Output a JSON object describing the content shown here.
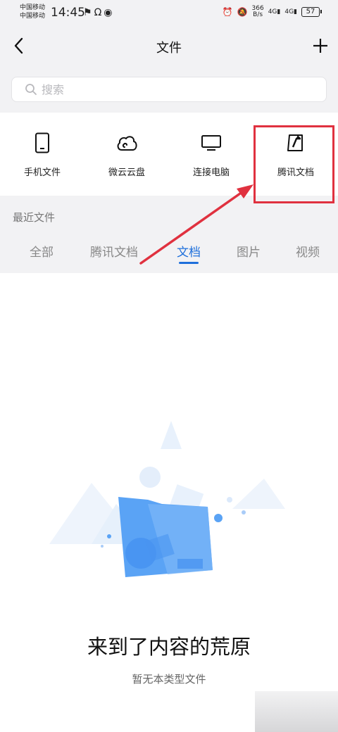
{
  "status_bar": {
    "carrier_1": "中国移动",
    "carrier_2": "中国移动",
    "time": "14:45",
    "speed_value": "366",
    "speed_unit": "B/s",
    "signal_1": "4G",
    "signal_2": "4G",
    "battery": "57"
  },
  "header": {
    "title": "文件"
  },
  "search": {
    "placeholder": "搜索"
  },
  "quick_access": [
    {
      "label": "手机文件",
      "icon": "phone-icon"
    },
    {
      "label": "微云云盘",
      "icon": "cloud-icon"
    },
    {
      "label": "连接电脑",
      "icon": "monitor-icon"
    },
    {
      "label": "腾讯文档",
      "icon": "tencent-docs-icon"
    }
  ],
  "recent": {
    "title": "最近文件",
    "tabs": [
      "全部",
      "腾讯文档",
      "文档",
      "图片",
      "视频"
    ],
    "active_tab": "文档"
  },
  "empty_state": {
    "title": "来到了内容的荒原",
    "subtitle": "暂无本类型文件"
  },
  "colors": {
    "accent": "#1e6fdb",
    "highlight": "#e0313f",
    "background_gray": "#f2f2f4"
  }
}
